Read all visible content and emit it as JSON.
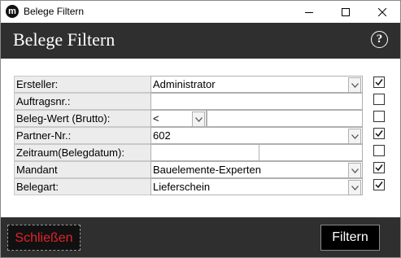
{
  "window": {
    "title": "Belege Filtern",
    "app_icon_letter": "m"
  },
  "header": {
    "title": "Belege Filtern",
    "help_symbol": "?"
  },
  "form": {
    "rows": [
      {
        "label": "Ersteller:",
        "value": "Administrator",
        "type": "dropdown",
        "checked": true
      },
      {
        "label": "Auftragsnr.:",
        "value": "",
        "type": "text",
        "checked": false
      },
      {
        "label": "Beleg-Wert (Brutto):",
        "operator": "<",
        "value": "",
        "type": "operator-text",
        "checked": false
      },
      {
        "label": "Partner-Nr.:",
        "value": "602",
        "type": "dropdown",
        "checked": true
      },
      {
        "label": "Zeitraum(Belegdatum):",
        "from": "",
        "to": "",
        "type": "range",
        "checked": false
      },
      {
        "label": "Mandant",
        "value": "Bauelemente-Experten",
        "type": "dropdown",
        "checked": true
      },
      {
        "label": "Belegart:",
        "value": "Lieferschein",
        "type": "dropdown",
        "checked": true
      }
    ]
  },
  "footer": {
    "close_label": "Schließen",
    "filter_label": "Filtern"
  },
  "colors": {
    "header_bg": "#2f2f2f",
    "close_text": "#e0242a"
  }
}
